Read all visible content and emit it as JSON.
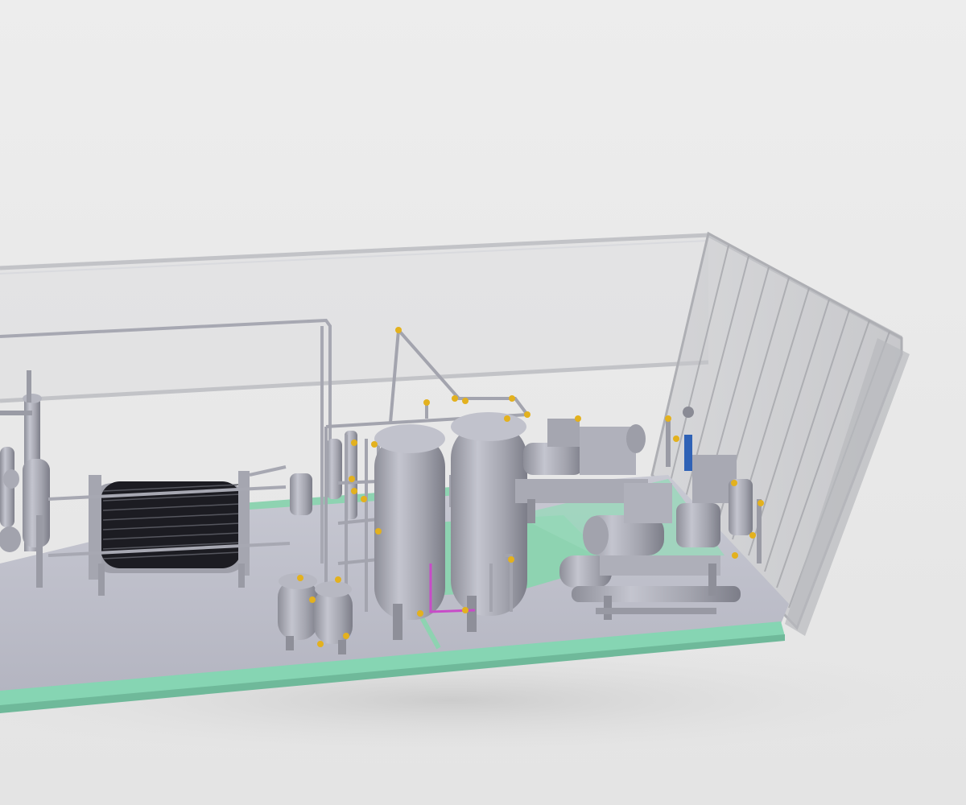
{
  "scene": {
    "subject": "",
    "colors": {
      "background": "#eaeaea",
      "floor": "#bfc0cc",
      "floor_edge": "#7fd6b0",
      "accent_pad": "#8fd3b0",
      "equipment": "#9fa0aa",
      "container_glass": "#cfd0d4",
      "fitting": "#e0b020",
      "valve": "#2a5fb0"
    }
  }
}
